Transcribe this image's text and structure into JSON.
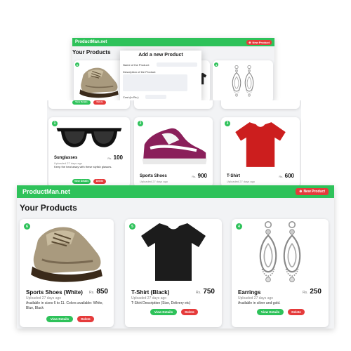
{
  "brand": "ProductMan.net",
  "new_product_label": "New Product",
  "new_product_icon": "plus-circle-icon",
  "page_heading": "Your Products",
  "currency": "Rs.",
  "view_label": "View Details",
  "delete_label": "Delete",
  "colors": {
    "accent": "#2ec25a",
    "danger": "#e53b3b",
    "background": "#f2f3f5"
  },
  "modal": {
    "title": "Add a new Product",
    "name_label": "Name of the Product:",
    "desc_label": "Description of the Product:",
    "cost_label": "Cost (in Rs.):"
  },
  "middle_cards": [
    {
      "id": "1",
      "title": "Sunglasses",
      "uploaded": "Uploaded 27 days ago",
      "price": "100",
      "description": "Keep the heat away with these stylish glasses.",
      "image": "sunglasses-image"
    },
    {
      "id": "2",
      "title": "Sports Shoes",
      "uploaded": "Uploaded 27 days ago",
      "price": "900",
      "description": "",
      "image": "sports-shoes-image"
    },
    {
      "id": "3",
      "title": "T-Shirt",
      "uploaded": "Uploaded 27 days ago",
      "price": "600",
      "description": "",
      "image": "red-tshirt-image"
    }
  ],
  "bottom_cards": [
    {
      "id": "6",
      "title": "Sports Shoes (White)",
      "uploaded": "Uploaded 27 days ago",
      "price": "850",
      "description": "Available in sizes 6 to 11. Colors available: White, Blue, Black",
      "image": "boot-image"
    },
    {
      "id": "5",
      "title": "T-Shirt (Black)",
      "uploaded": "Uploaded 27 days ago",
      "price": "750",
      "description": "T-Shirt Description (Size, Delivery etc)",
      "image": "black-tshirt-image"
    },
    {
      "id": "4",
      "title": "Earrings",
      "uploaded": "Uploaded 27 days ago",
      "price": "250",
      "description": "Available in silver and gold.",
      "image": "earrings-image"
    }
  ],
  "top_badges": [
    "6",
    "5",
    "4"
  ]
}
